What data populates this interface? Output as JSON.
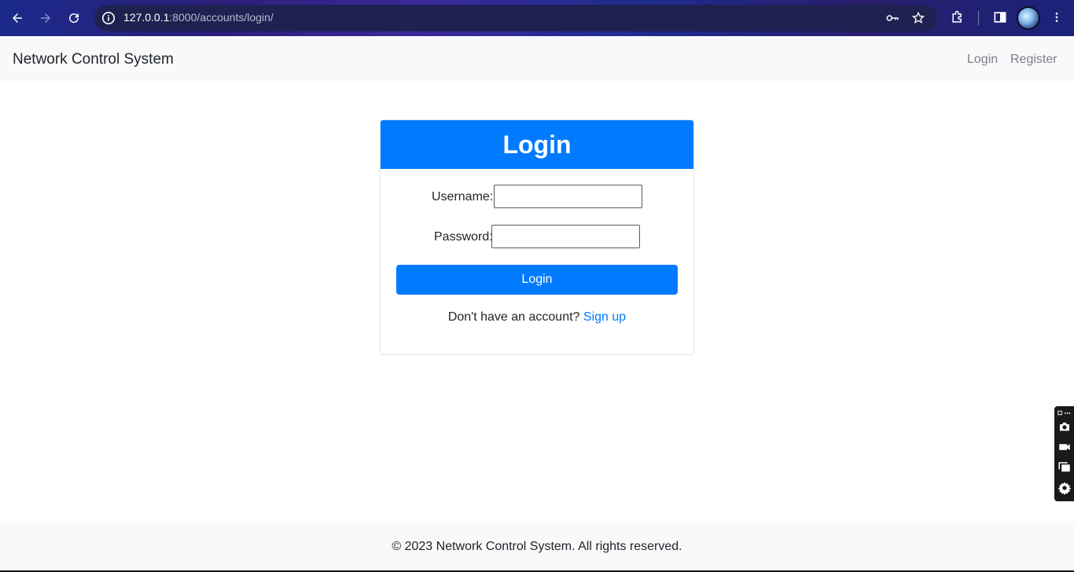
{
  "browser": {
    "url_host": "127.0.0.1",
    "url_path": ":8000/accounts/login/"
  },
  "navbar": {
    "brand": "Network Control System",
    "links": [
      "Login",
      "Register"
    ]
  },
  "card": {
    "title": "Login",
    "username_label": "Username:",
    "password_label": "Password:",
    "username_value": "",
    "password_value": "",
    "submit_label": "Login",
    "signup_prompt": "Don't have an account?",
    "signup_link": "Sign up"
  },
  "footer": {
    "text": "© 2023 Network Control System. All rights reserved."
  },
  "colors": {
    "primary": "#007bff",
    "navbar_bg": "#f8f9fa"
  },
  "icons": [
    "back-arrow-icon",
    "forward-arrow-icon",
    "reload-icon",
    "site-info-icon",
    "key-icon",
    "star-icon",
    "extensions-icon",
    "side-panel-icon",
    "avatar",
    "kebab-menu-icon",
    "camera-icon",
    "video-icon",
    "windows-icon",
    "gear-icon"
  ]
}
